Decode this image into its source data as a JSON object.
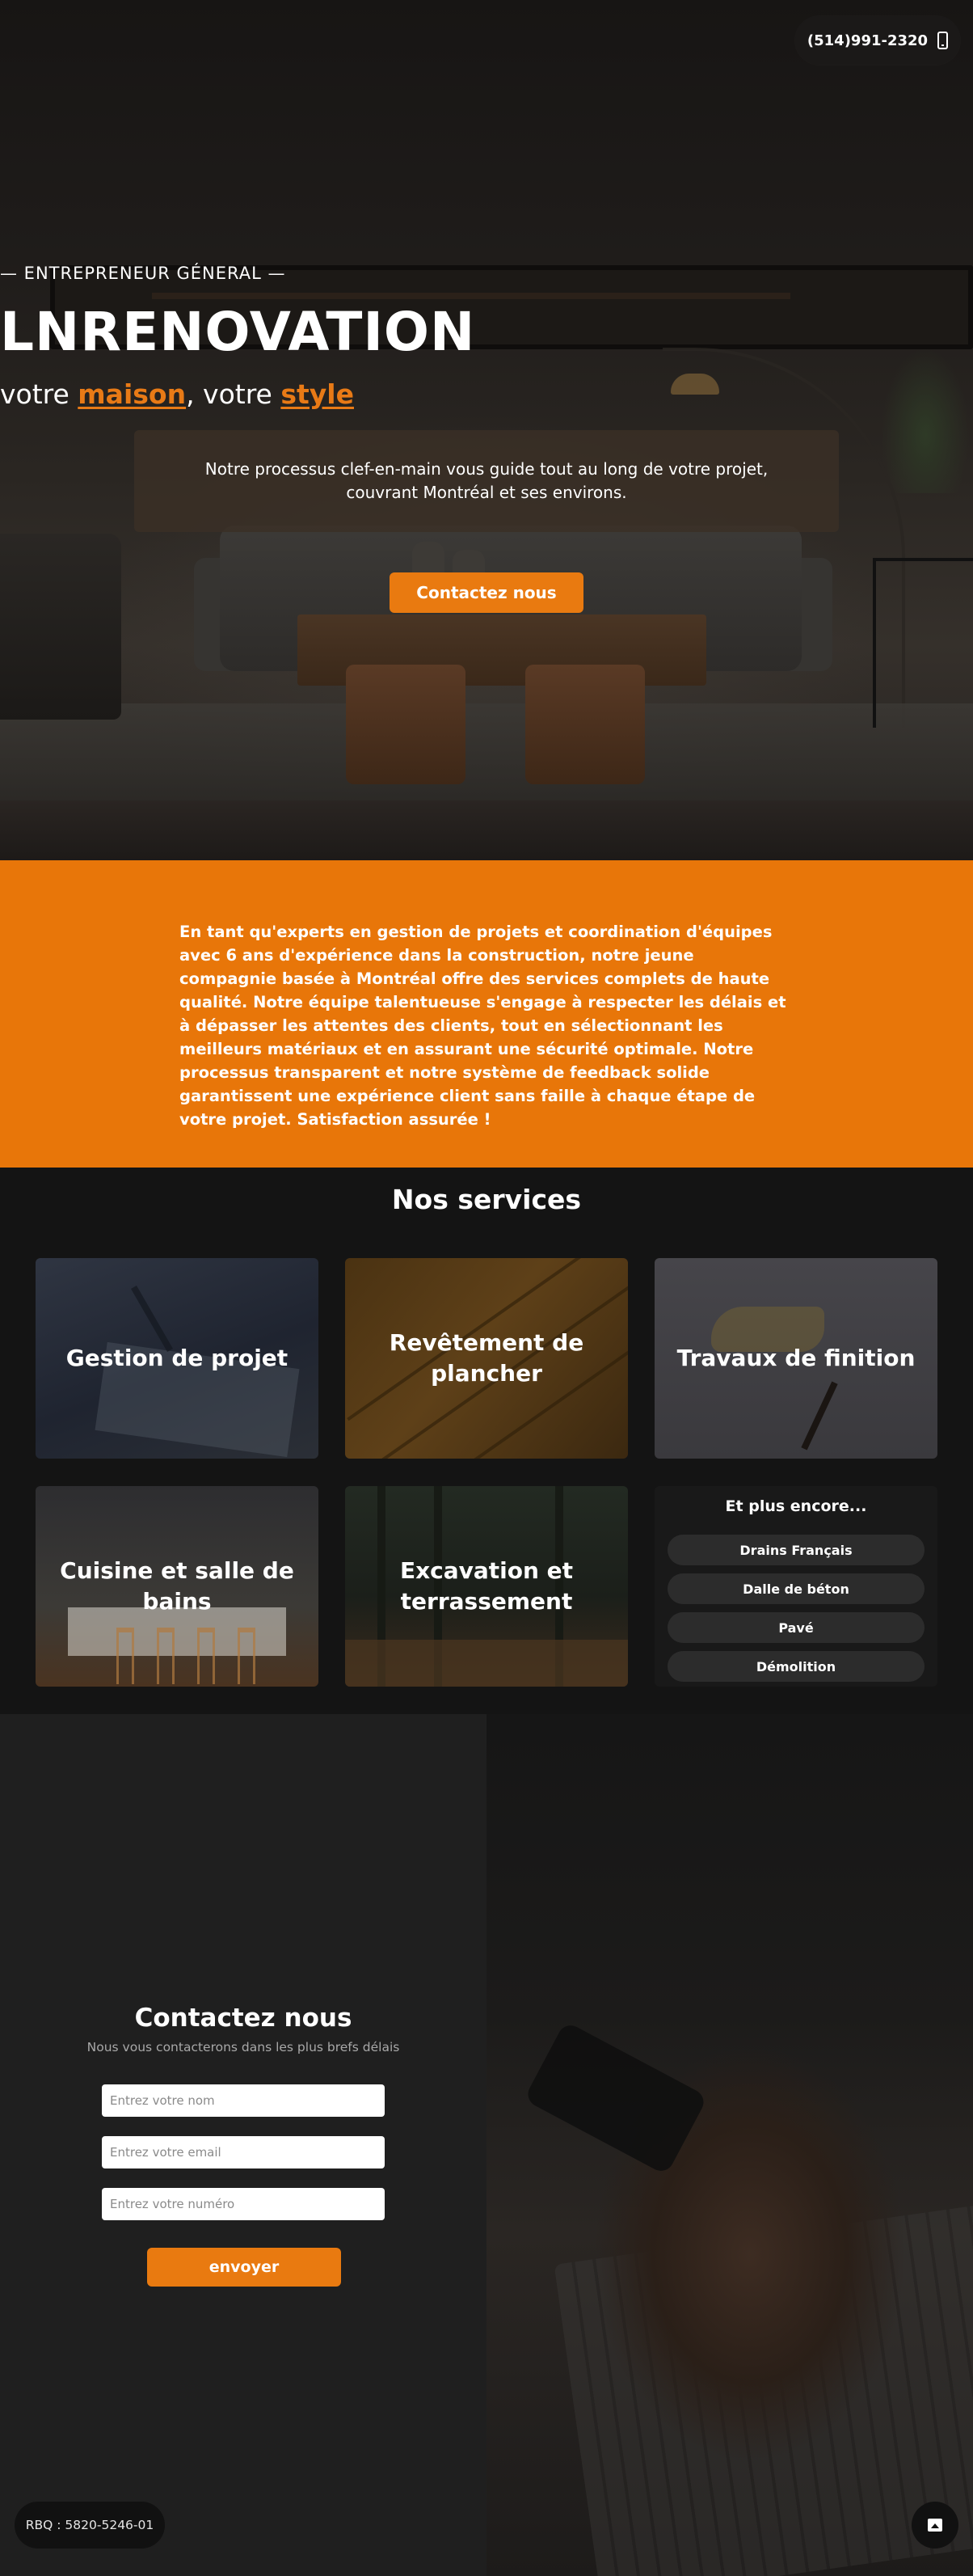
{
  "header": {
    "phone": "(514)991-2320",
    "phone_icon": "mobile-phone-icon"
  },
  "hero": {
    "eyebrow": "— ENTREPRENEUR GÉNERAL —",
    "brand": "LNRENOVATION",
    "tagline_prefix": "votre ",
    "tagline_word1": "maison",
    "tagline_middle": ", votre ",
    "tagline_word2": "style",
    "intro": "Notre processus clef-en-main vous guide tout au long de votre projet, couvrant Montréal et ses environs.",
    "cta_label": "Contactez nous"
  },
  "about": {
    "text": "En tant qu'experts en gestion de projets et coordination d'équipes avec 6 ans d'expérience dans la construction, notre jeune compagnie basée à Montréal offre des services complets de haute qualité. Notre équipe talentueuse s'engage à respecter les délais et à dépasser les attentes des clients, tout en sélectionnant les meilleurs matériaux et en assurant une sécurité optimale. Notre processus transparent et notre système de feedback solide garantissent une expérience client sans faille à chaque étape de votre projet. Satisfaction assurée !"
  },
  "services": {
    "title": "Nos services",
    "cards": [
      {
        "label": "Gestion de projet"
      },
      {
        "label": "Revêtement de plancher"
      },
      {
        "label": "Travaux de finition"
      },
      {
        "label": "Cuisine et salle de bains"
      },
      {
        "label": "Excavation et terrassement"
      }
    ],
    "more": {
      "title": "Et plus encore...",
      "items": [
        "Drains Français",
        "Dalle de béton",
        "Pavé",
        "Démolition"
      ]
    }
  },
  "contact": {
    "title": "Contactez nous",
    "subtitle": "Nous vous contacterons dans les plus brefs délais",
    "name_placeholder": "Entrez votre nom",
    "email_placeholder": "Entrez votre email",
    "phone_placeholder": "Entrez votre numéro",
    "submit_label": "envoyer"
  },
  "footer": {
    "rbq": "RBQ : 5820-5246-01",
    "image_icon": "image-icon"
  },
  "colors": {
    "accent": "#e87609",
    "dark": "#141414",
    "panel": "#1f1f1f"
  }
}
